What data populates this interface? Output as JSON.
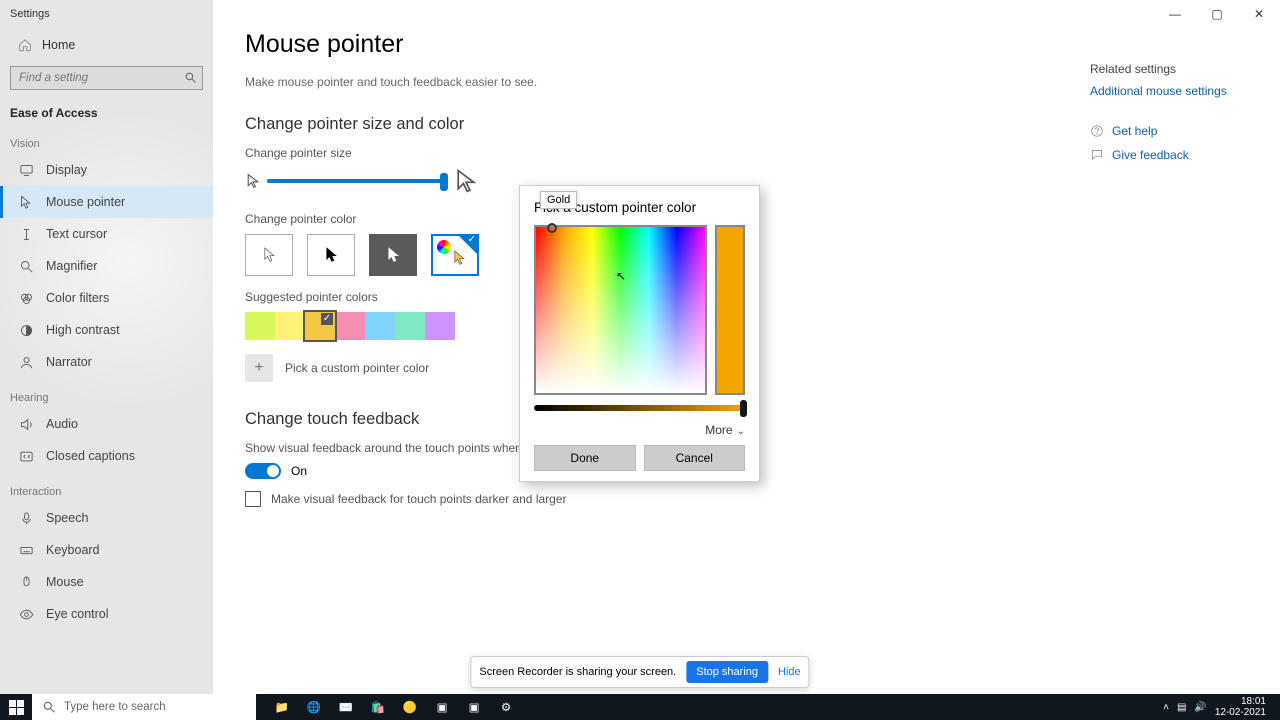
{
  "window": {
    "app_title": "Settings"
  },
  "sidebar": {
    "home": "Home",
    "search_placeholder": "Find a setting",
    "section": "Ease of Access",
    "cat_vision": "Vision",
    "items_vision": [
      {
        "label": "Display",
        "icon": "display"
      },
      {
        "label": "Mouse pointer",
        "icon": "mouse",
        "active": true
      },
      {
        "label": "Text cursor",
        "icon": "text"
      },
      {
        "label": "Magnifier",
        "icon": "mag"
      },
      {
        "label": "Color filters",
        "icon": "filter"
      },
      {
        "label": "High contrast",
        "icon": "contrast"
      },
      {
        "label": "Narrator",
        "icon": "narrator"
      }
    ],
    "cat_hearing": "Hearing",
    "items_hearing": [
      {
        "label": "Audio",
        "icon": "audio"
      },
      {
        "label": "Closed captions",
        "icon": "cc"
      }
    ],
    "cat_interaction": "Interaction",
    "items_interaction": [
      {
        "label": "Speech",
        "icon": "mic"
      },
      {
        "label": "Keyboard",
        "icon": "kbd"
      },
      {
        "label": "Mouse",
        "icon": "mouse2"
      },
      {
        "label": "Eye control",
        "icon": "eye"
      }
    ]
  },
  "main": {
    "title": "Mouse pointer",
    "subtitle": "Make mouse pointer and touch feedback easier to see.",
    "h_size_color": "Change pointer size and color",
    "lbl_size": "Change pointer size",
    "lbl_color": "Change pointer color",
    "lbl_suggested": "Suggested pointer colors",
    "pick_custom": "Pick a custom pointer color",
    "h_touch": "Change touch feedback",
    "touch_desc": "Show visual feedback around the touch points when I touch the screen",
    "toggle_state": "On",
    "chk_larger": "Make visual feedback for touch points darker and larger",
    "suggested_colors": [
      "#d7f75b",
      "#fff176",
      "#f2c744",
      "#f48fb1",
      "#81d4fa",
      "#80e8c6",
      "#ce93ff"
    ],
    "suggested_selected_index": 2
  },
  "dialog": {
    "title": "Pick a custom pointer color",
    "tooltip": "Gold",
    "preview_color": "#f5a500",
    "more": "More",
    "done": "Done",
    "cancel": "Cancel"
  },
  "right": {
    "hdr": "Related settings",
    "link": "Additional mouse settings",
    "help": "Get help",
    "feedback": "Give feedback"
  },
  "sharebar": {
    "msg": "Screen Recorder is sharing your screen.",
    "stop": "Stop sharing",
    "hide": "Hide"
  },
  "taskbar": {
    "search_placeholder": "Type here to search",
    "time": "18:01",
    "date": "12-02-2021"
  }
}
